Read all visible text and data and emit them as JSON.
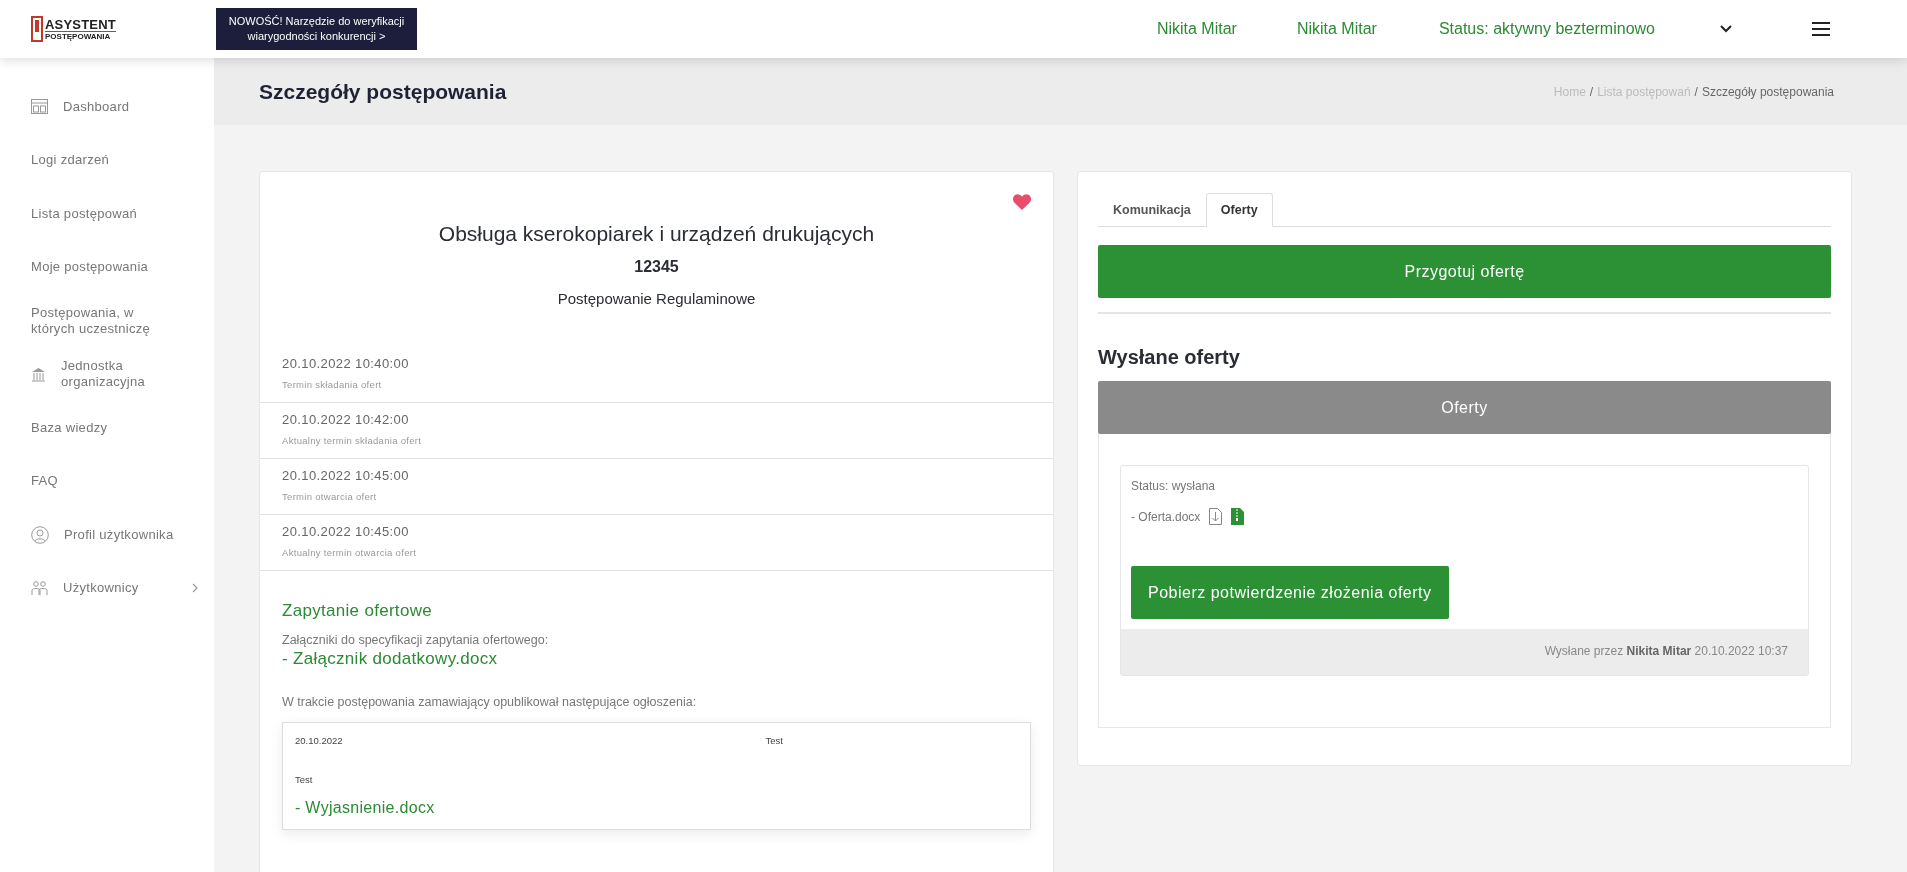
{
  "header": {
    "logo": {
      "top": "ASYSTENT",
      "bottom": "POSTĘPOWANIA"
    },
    "banner": "NOWOŚĆ! Narzędzie do weryfikacji wiarygodności konkurencji >",
    "user_links": [
      "Nikita Mitar",
      "Nikita Mitar",
      "Status: aktywny bezterminowo"
    ]
  },
  "sidebar": {
    "items": [
      {
        "label": "Dashboard",
        "kind": "dashboard",
        "expandable": false
      },
      {
        "label": "Logi zdarzeń",
        "kind": "plain",
        "expandable": false
      },
      {
        "label": "Lista postępowań",
        "kind": "plain",
        "expandable": false
      },
      {
        "label": "Moje postępowania",
        "kind": "plain",
        "expandable": false
      },
      {
        "label": "Postępowania, w których uczestniczę",
        "kind": "plain",
        "expandable": false
      },
      {
        "label": "Jednostka organizacyjna",
        "kind": "unit",
        "expandable": false
      },
      {
        "label": "Baza wiedzy",
        "kind": "plain",
        "expandable": false
      },
      {
        "label": "FAQ",
        "kind": "plain",
        "expandable": false
      },
      {
        "label": "Profil użytkownika",
        "kind": "profile",
        "expandable": false
      },
      {
        "label": "Użytkownicy",
        "kind": "users",
        "expandable": true
      }
    ]
  },
  "page": {
    "title": "Szczegóły postępowania",
    "breadcrumb_separator": "/",
    "breadcrumb": [
      {
        "label": "Home",
        "current": false
      },
      {
        "label": "Lista postępowań",
        "current": false
      },
      {
        "label": "Szczegóły postępowania",
        "current": true
      }
    ]
  },
  "details": {
    "favorite": true,
    "title": "Obsługa kserokopiarek i urządzeń drukujących",
    "number": "12345",
    "type": "Postępowanie Regulaminowe",
    "dates": [
      {
        "value": "20.10.2022 10:40:00",
        "label": "Termin składania ofert"
      },
      {
        "value": "20.10.2022 10:42:00",
        "label": "Aktualny termin składania ofert"
      },
      {
        "value": "20.10.2022 10:45:00",
        "label": "Termin otwarcia ofert"
      },
      {
        "value": "20.10.2022 10:45:00",
        "label": "Aktualny termin otwarcia ofert"
      }
    ],
    "inquiry": {
      "heading": "Zapytanie ofertowe",
      "attachments_label": "Załączniki do specyfikacji zapytania ofertowego:",
      "attachments": [
        "- Załącznik dodatkowy.docx"
      ],
      "announcements_label": "W trakcie postępowania zamawiający opublikował następujące ogłoszenia:",
      "announcements": [
        {
          "date": "20.10.2022",
          "title": "Test",
          "body": "Test",
          "files": [
            "- Wyjasnienie.docx"
          ]
        }
      ]
    }
  },
  "offers_panel": {
    "tabs": [
      {
        "label": "Komunikacja",
        "selected": false
      },
      {
        "label": "Oferty",
        "selected": true
      }
    ],
    "prepare_button": "Przygotuj ofertę",
    "sent_heading": "Wysłane oferty",
    "section_bar": "Oferty",
    "offers": [
      {
        "status": "Status: wysłana",
        "file": "- Oferta.docx",
        "confirm_button": "Pobierz potwierdzenie złożenia oferty",
        "footer": "Wysłane przez **Nikita Mitar** 20.10.2022 10:37"
      }
    ]
  }
}
